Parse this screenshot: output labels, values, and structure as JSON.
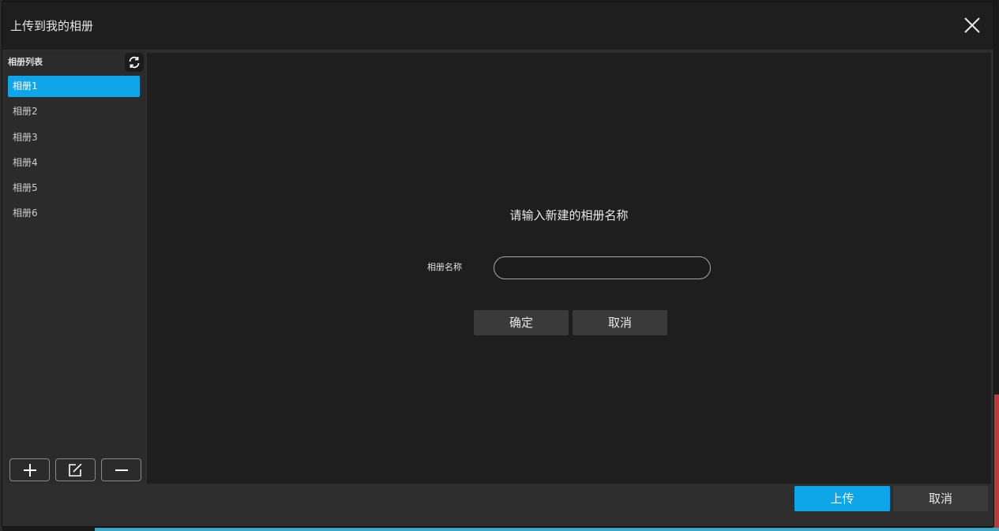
{
  "window": {
    "title": "上传到我的相册"
  },
  "sidebar": {
    "header": "相册列表",
    "items": [
      {
        "label": "相册1",
        "active": true
      },
      {
        "label": "相册2"
      },
      {
        "label": "相册3"
      },
      {
        "label": "相册4"
      },
      {
        "label": "相册5"
      },
      {
        "label": "相册6"
      }
    ],
    "tools": [
      "add-icon",
      "edit-icon",
      "remove-icon"
    ]
  },
  "main": {
    "prompt": "请输入新建的相册名称",
    "field_label": "相册名称",
    "field_value": "",
    "confirm_label": "确定",
    "cancel_label": "取消"
  },
  "footer": {
    "upload_label": "上传",
    "cancel_label": "取消"
  },
  "colors": {
    "accent": "#0ea5e9",
    "panel": "#1e1e1e",
    "sidebar": "#2b2b2b"
  }
}
